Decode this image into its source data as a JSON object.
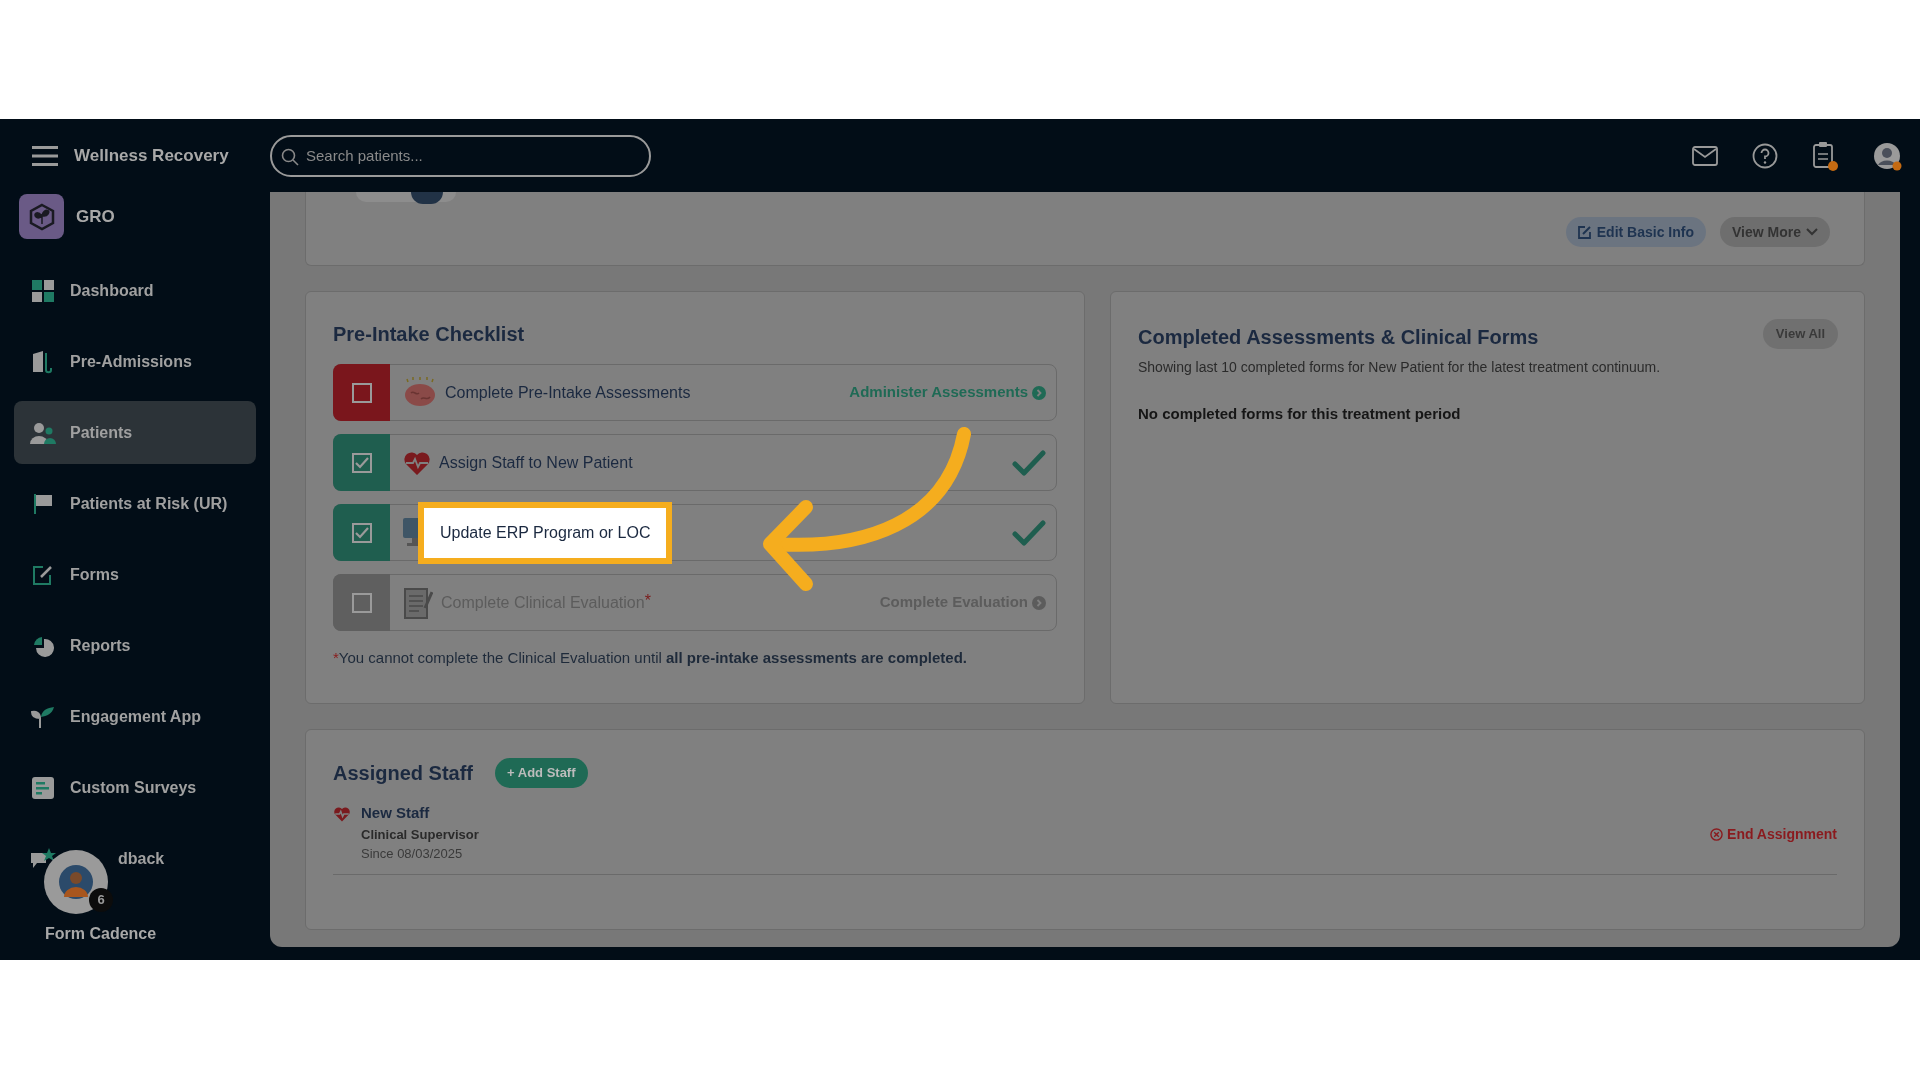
{
  "app": {
    "name": "Wellness Recovery"
  },
  "search": {
    "placeholder": "Search patients..."
  },
  "org": {
    "name": "GRO"
  },
  "sidebar": {
    "items": [
      {
        "label": "Dashboard",
        "selected": false
      },
      {
        "label": "Pre-Admissions",
        "selected": false
      },
      {
        "label": "Patients",
        "selected": true
      },
      {
        "label": "Patients at Risk (UR)",
        "selected": false
      },
      {
        "label": "Forms",
        "selected": false
      },
      {
        "label": "Reports",
        "selected": false
      },
      {
        "label": "Engagement App",
        "selected": false
      },
      {
        "label": "Custom Surveys",
        "selected": false
      },
      {
        "label": "dback",
        "selected": false
      }
    ]
  },
  "form_cadence": {
    "label": "Form Cadence",
    "badge": "6"
  },
  "patient_card": {
    "buttons": [
      {
        "label": "Edit Basic Info",
        "kind": "edit"
      },
      {
        "label": "View More",
        "kind": "more"
      }
    ]
  },
  "checklist": {
    "title": "Pre-Intake Checklist",
    "items": [
      {
        "label": "Complete Pre-Intake Assessments",
        "kind": "pending",
        "checked": false,
        "action": "Administer Assessments",
        "highlighted": false
      },
      {
        "label": "Assign Staff to New Patient",
        "kind": "done",
        "checked": true,
        "highlighted": false
      },
      {
        "label": "Update ERP Program or LOC",
        "kind": "done",
        "checked": true,
        "highlighted": true
      },
      {
        "label": "Complete Clinical Evaluation",
        "suffix": "*",
        "kind": "locked",
        "checked": false,
        "action": "Complete Evaluation",
        "highlighted": false
      }
    ],
    "note": {
      "mark": "*",
      "text": "You cannot complete the Clinical Evaluation until **all pre-intake assessments are completed.**"
    }
  },
  "completed_forms": {
    "title": "Completed Assessments & Clinical Forms",
    "button": "View All",
    "subtitle": "Showing last 10 completed forms for New Patient for the latest treatment continuum.",
    "empty": "No completed forms for this treatment period"
  },
  "assigned_staff": {
    "title": "Assigned Staff",
    "add_button": "+ Add Staff",
    "staff": [
      {
        "name": "New Staff",
        "role": "Clinical Supervisor",
        "since": "Since 08/03/2025",
        "action": "End Assignment"
      }
    ]
  }
}
